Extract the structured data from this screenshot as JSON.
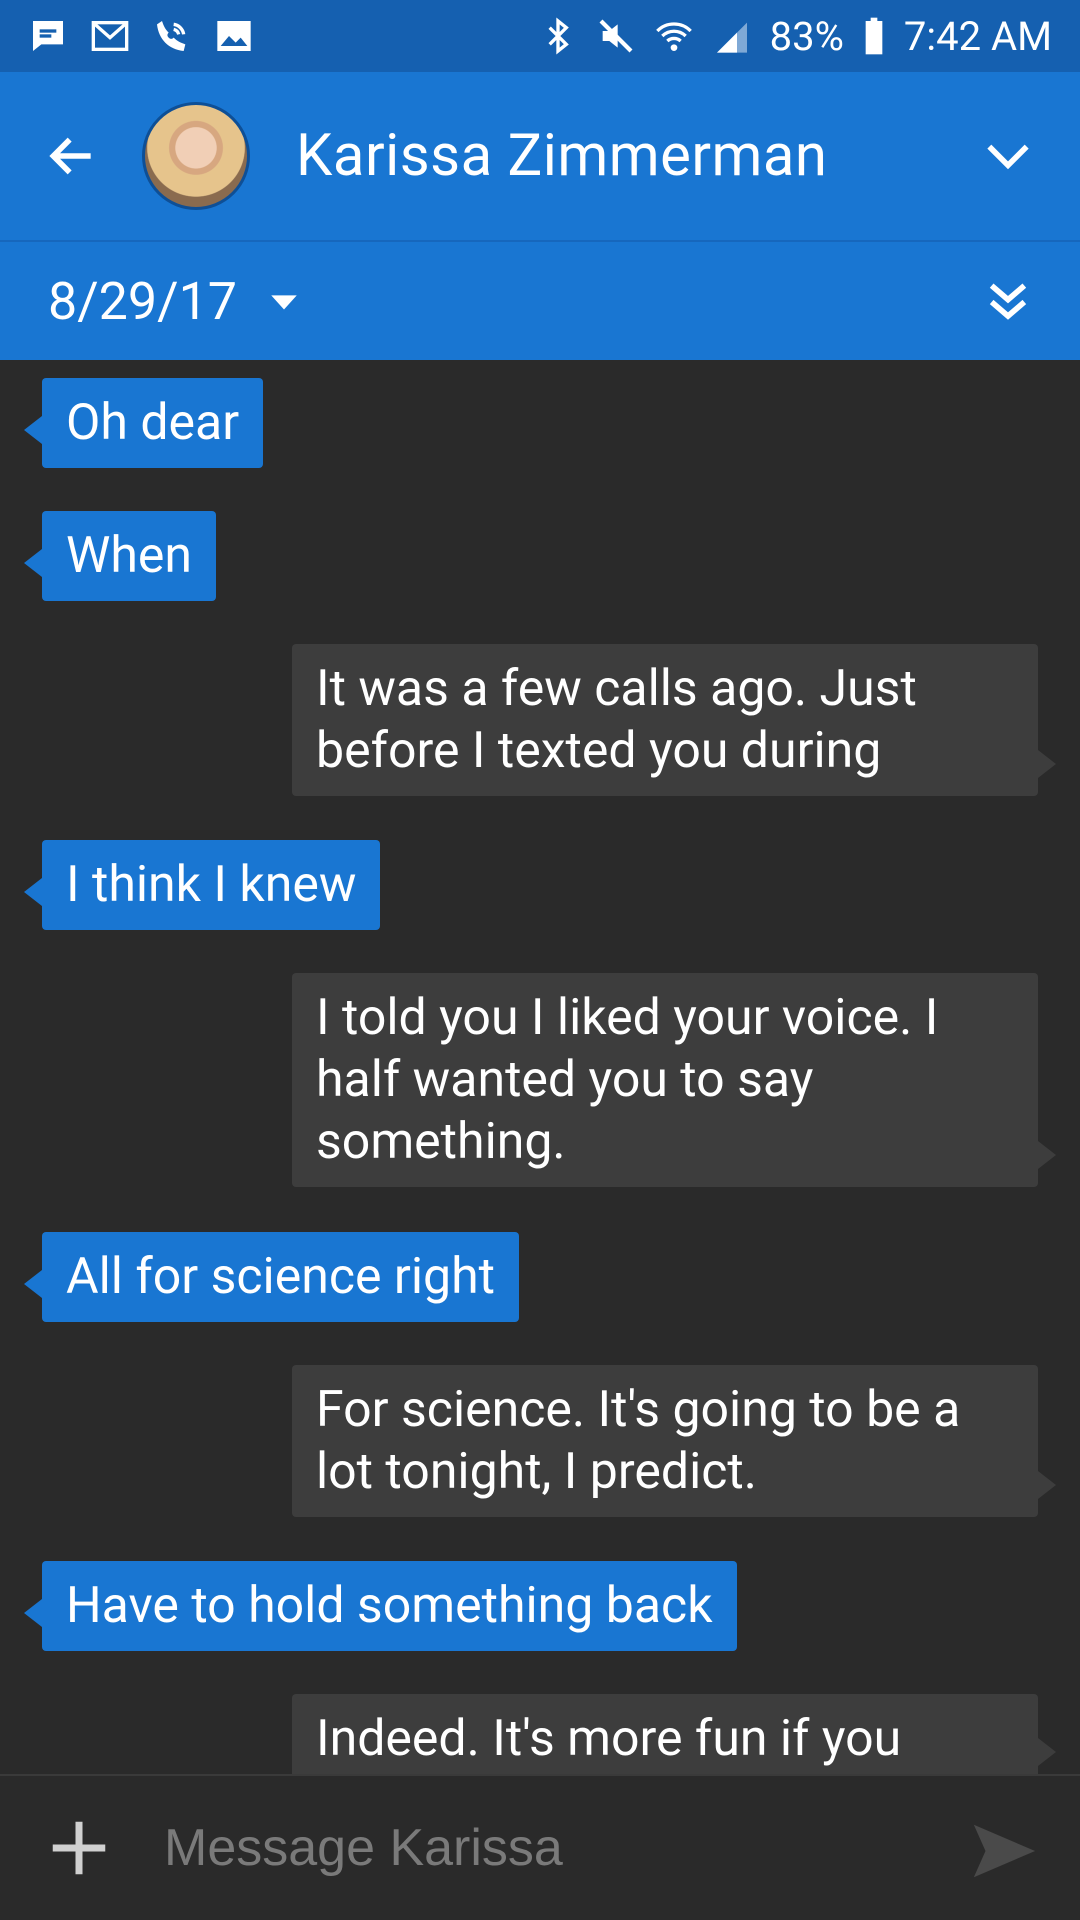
{
  "status_bar": {
    "battery": "83%",
    "time": "7:42 AM",
    "left_icons": [
      "message-notification-icon",
      "gmail-icon",
      "wifi-calling-icon",
      "image-notification-icon"
    ],
    "right_icons": [
      "bluetooth-icon",
      "mute-icon",
      "wifi-icon",
      "signal-icon",
      "battery-icon"
    ]
  },
  "header": {
    "contact_name": "Karissa Zimmerman"
  },
  "date_bar": {
    "date": "8/29/17"
  },
  "messages": [
    {
      "direction": "in",
      "text": "Oh dear"
    },
    {
      "direction": "in",
      "text": "When"
    },
    {
      "direction": "out",
      "text": "It was a few calls ago. Just before I texted you during"
    },
    {
      "direction": "in",
      "text": "I think I knew"
    },
    {
      "direction": "out",
      "text": "I told you I liked your voice. I half wanted you to say something."
    },
    {
      "direction": "in",
      "text": "All for science right"
    },
    {
      "direction": "out",
      "text": "For science. It's going to be a lot tonight, I predict."
    },
    {
      "direction": "in",
      "text": "Have to hold something back"
    },
    {
      "direction": "out",
      "text": "Indeed. It's more fun if you"
    }
  ],
  "composer": {
    "placeholder": "Message Karissa"
  },
  "colors": {
    "status_bar": "#1560b0",
    "header": "#1976d2",
    "incoming_bubble": "#1976d2",
    "outgoing_bubble": "#3d3d3d",
    "background": "#2a2a2a"
  }
}
